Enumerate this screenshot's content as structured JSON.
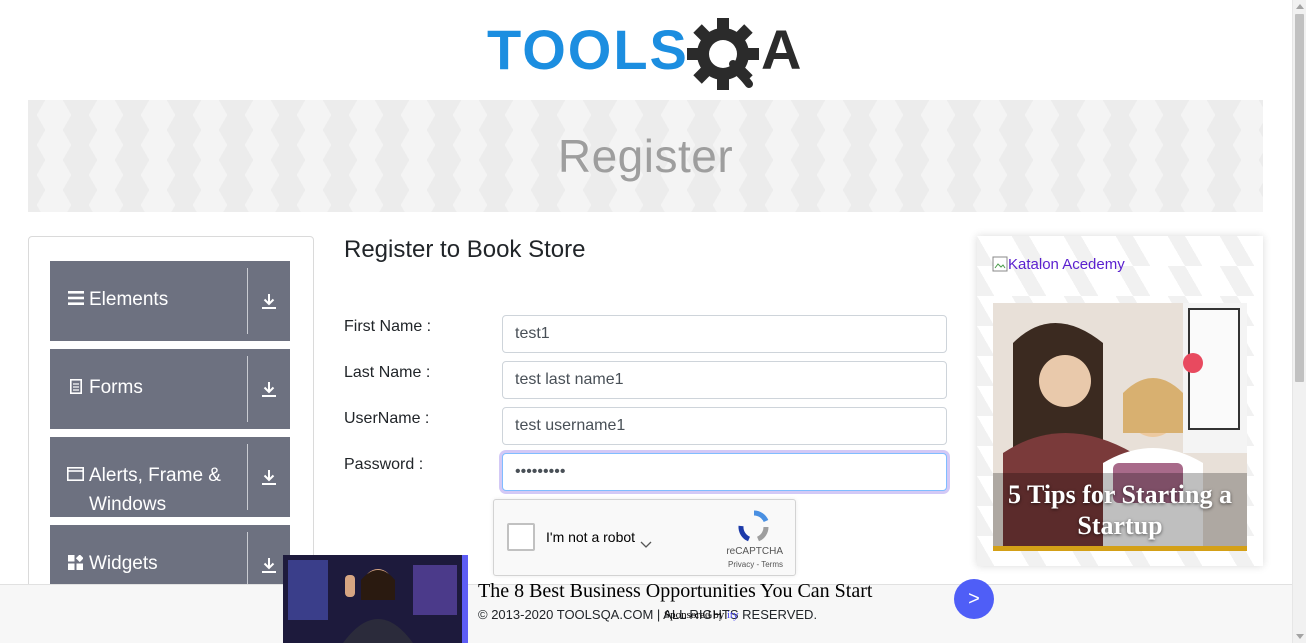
{
  "logo": {
    "text": "TOOLSQA",
    "part1": "TOOLS",
    "part2": "QA"
  },
  "banner": {
    "title": "Register"
  },
  "sidebar": {
    "groups": [
      {
        "label": "Elements",
        "icon": "menu-icon"
      },
      {
        "label": "Forms",
        "icon": "document-icon"
      },
      {
        "label": "Alerts, Frame & Windows",
        "icon": "window-icon"
      },
      {
        "label": "Widgets",
        "icon": "widgets-icon"
      }
    ]
  },
  "form": {
    "title": "Register to Book Store",
    "first_name_label": "First Name :",
    "first_name_value": "test1",
    "last_name_label": "Last Name :",
    "last_name_value": "test last name1",
    "username_label": "UserName :",
    "username_value": "test username1",
    "password_label": "Password :",
    "password_value": "•••••••••"
  },
  "captcha": {
    "label": "I'm not a robot",
    "brand": "reCAPTCHA",
    "links": "Privacy - Terms"
  },
  "ad_card": {
    "alt_text": "Katalon Acedemy",
    "caption": "5 Tips for Starting a Startup"
  },
  "bottom_ad": {
    "title": "The 8 Best Business Opportunities You Can Start",
    "sponsor_prefix": "Sponsored by",
    "sponsor_name": "ity",
    "button": ">"
  },
  "footer": {
    "copyright": "© 2013-2020 TOOLSQA.COM | ALL RIGHTS RESERVED."
  },
  "colors": {
    "sidebar_group": "#6d7180",
    "logo_blue": "#1c8ee0",
    "logo_dark": "#2b2b2b",
    "ad_button": "#4f5ef7"
  }
}
